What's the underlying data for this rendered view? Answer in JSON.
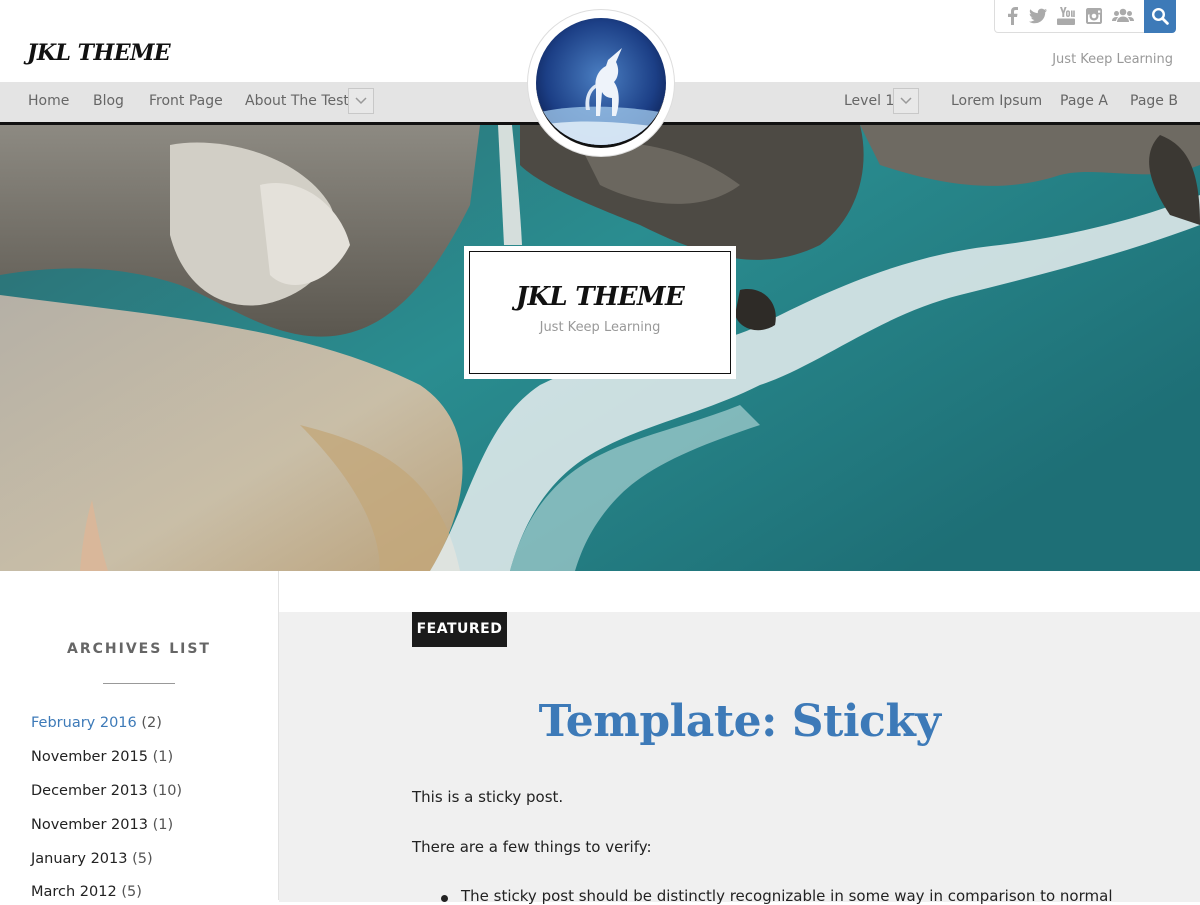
{
  "site": {
    "title": "JKL THEME",
    "tagline": "Just Keep Learning"
  },
  "social": [
    "facebook-icon",
    "twitter-icon",
    "youtube-icon",
    "instagram-icon",
    "users-icon"
  ],
  "nav": {
    "left": [
      "Home",
      "Blog",
      "Front Page",
      "About The Tests"
    ],
    "right": [
      "Level 1",
      "Lorem Ipsum",
      "Page A",
      "Page B"
    ]
  },
  "sidebar": {
    "widget_title": "ARCHIVES LIST",
    "archives": [
      {
        "label": "February 2016",
        "count": "(2)"
      },
      {
        "label": "November 2015",
        "count": "(1)"
      },
      {
        "label": "December 2013",
        "count": "(10)"
      },
      {
        "label": "November 2013",
        "count": "(1)"
      },
      {
        "label": "January 2013",
        "count": "(5)"
      },
      {
        "label": "March 2012",
        "count": "(5)"
      }
    ]
  },
  "post": {
    "badge": "FEATURED",
    "title": "Template: Sticky",
    "paragraphs": [
      "This is a sticky post.",
      "There are a few things to verify:"
    ],
    "list": [
      "The sticky post should be distinctly recognizable in some way in comparison to normal"
    ]
  },
  "colors": {
    "accent": "#3d7ab8",
    "nav_bg": "#e4e4e4",
    "badge_bg": "#1b1b1b"
  }
}
